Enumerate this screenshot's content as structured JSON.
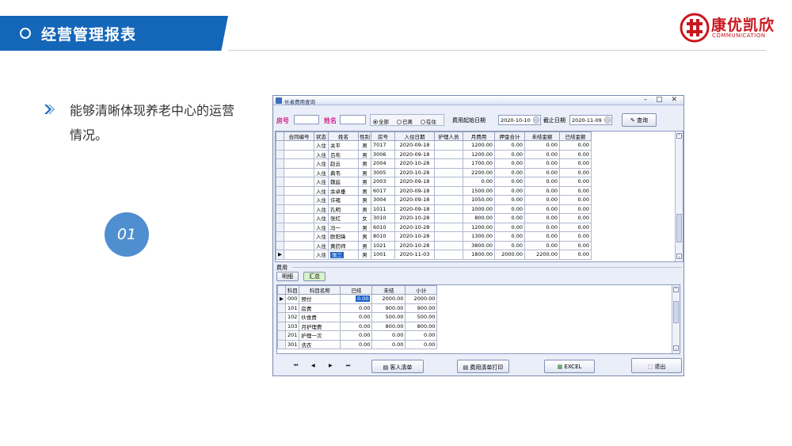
{
  "slide": {
    "title": "经营管理报表",
    "bullet_text": "能够清晰体现养老中心的运营情况。",
    "number": "01"
  },
  "logo": {
    "name_cn": "康优凯欣",
    "name_en": "COMMUNICATION"
  },
  "app": {
    "title": "长者费用查询",
    "filter": {
      "room_label": "房号",
      "name_label": "姓名",
      "room_value": "",
      "name_value": "",
      "radio_all": "全部",
      "radio_left": "已离",
      "radio_in": "在住",
      "start_label": "费用起始日期",
      "start_date": "2020-10-10",
      "end_label": "截止日期",
      "end_date": "2020-11-09",
      "query_button": "查询"
    },
    "main_table": {
      "columns": [
        "合同编号",
        "状态",
        "姓名",
        "性别",
        "房号",
        "入住日期",
        "护理人员",
        "月费用",
        "押金合计",
        "未结金额",
        "已结金额"
      ],
      "rows": [
        [
          "",
          "入住",
          "关平",
          "男",
          "7017",
          "2020-09-18",
          "",
          "1200.00",
          "0.00",
          "0.00",
          "0.00"
        ],
        [
          "",
          "入住",
          "吕布",
          "男",
          "3006",
          "2020-09-18",
          "",
          "1200.00",
          "0.00",
          "0.00",
          "0.00"
        ],
        [
          "",
          "入住",
          "赵云",
          "男",
          "2004",
          "2020-10-28",
          "",
          "1700.00",
          "0.00",
          "0.00",
          "0.00"
        ],
        [
          "",
          "入住",
          "典韦",
          "男",
          "3005",
          "2020-10-28",
          "",
          "2200.00",
          "0.00",
          "0.00",
          "0.00"
        ],
        [
          "",
          "入住",
          "魏延",
          "男",
          "2003",
          "2020-09-18",
          "",
          "0.00",
          "0.00",
          "0.00",
          "0.00"
        ],
        [
          "",
          "入住",
          "余卓垂",
          "男",
          "6017",
          "2020-09-18",
          "",
          "1500.00",
          "0.00",
          "0.00",
          "0.00"
        ],
        [
          "",
          "入住",
          "许褚",
          "男",
          "3004",
          "2020-09-18",
          "",
          "1050.00",
          "0.00",
          "0.00",
          "0.00"
        ],
        [
          "",
          "入住",
          "孔明",
          "男",
          "1011",
          "2020-09-18",
          "",
          "1000.00",
          "0.00",
          "0.00",
          "0.00"
        ],
        [
          "",
          "入住",
          "张红",
          "女",
          "3010",
          "2020-10-28",
          "",
          "800.00",
          "0.00",
          "0.00",
          "0.00"
        ],
        [
          "",
          "入住",
          "冯一",
          "男",
          "6010",
          "2020-10-28",
          "",
          "1200.00",
          "0.00",
          "0.00",
          "0.00"
        ],
        [
          "",
          "入住",
          "欧阳锋",
          "男",
          "8010",
          "2020-10-28",
          "",
          "1300.00",
          "0.00",
          "0.00",
          "0.00"
        ],
        [
          "",
          "入住",
          "黄药师",
          "男",
          "1021",
          "2020-10-28",
          "",
          "3800.00",
          "0.00",
          "0.00",
          "0.00"
        ],
        [
          "",
          "入住",
          "张三",
          "男",
          "1001",
          "2020-11-03",
          "",
          "1800.00",
          "2000.00",
          "2200.00",
          "0.00"
        ]
      ],
      "selected_row": 12
    },
    "fee_section": {
      "label": "费用",
      "tab_detail": "明细",
      "tab_summary": "汇总",
      "columns": [
        "科目",
        "科目名称",
        "已结",
        "未结",
        "小计"
      ],
      "rows": [
        [
          "000",
          "预付",
          "0.00",
          "2000.00",
          "2000.00"
        ],
        [
          "101",
          "房费",
          "0.00",
          "900.00",
          "900.00"
        ],
        [
          "102",
          "伙食费",
          "0.00",
          "500.00",
          "500.00"
        ],
        [
          "103",
          "月护理费",
          "0.00",
          "800.00",
          "800.00"
        ],
        [
          "201",
          "护理一次",
          "0.00",
          "0.00",
          "0.00"
        ],
        [
          "301",
          "洗衣",
          "0.00",
          "0.00",
          "0.00"
        ]
      ]
    },
    "bottom": {
      "nav_first": "⏮",
      "nav_prev": "◀",
      "nav_next": "▶",
      "nav_last": "⏭",
      "guest_list": "客人清单",
      "print_fee": "费用清单打印",
      "excel": "EXCEL",
      "exit": "退出"
    }
  },
  "colors": {
    "banner": "#1466b8",
    "brand_red": "#c8161d",
    "circle": "#4f8fd0",
    "label_magenta": "#d61f8a"
  }
}
